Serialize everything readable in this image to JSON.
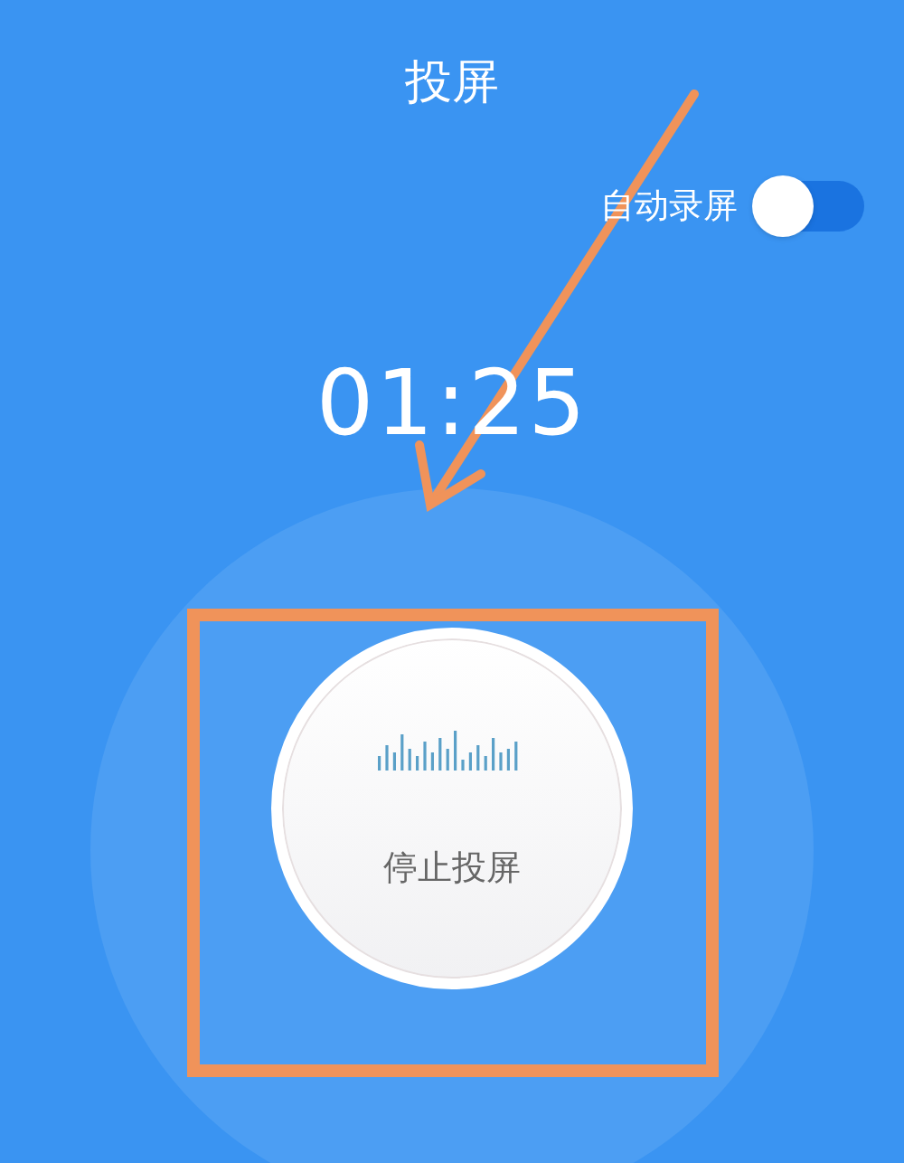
{
  "header": {
    "title": "投屏"
  },
  "auto_record": {
    "label": "自动录屏",
    "on": false
  },
  "timer": "01:25",
  "stop_button": {
    "label": "停止投屏"
  }
}
